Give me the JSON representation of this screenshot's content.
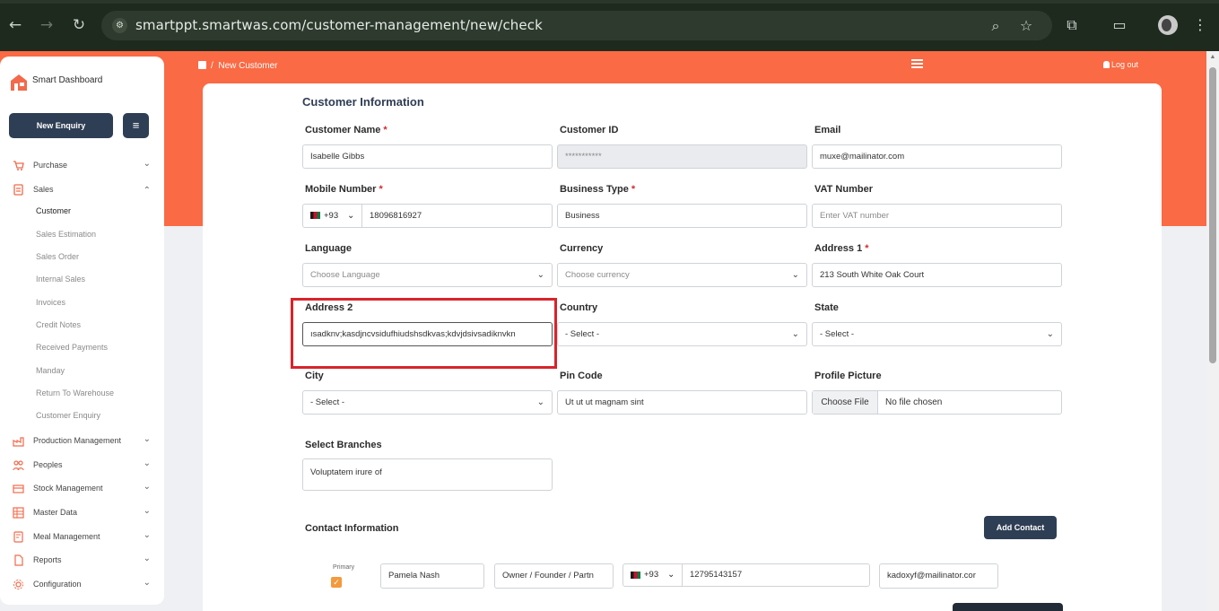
{
  "browser": {
    "url": "smartppt.smartwas.com/customer-management/new/check"
  },
  "sidebar": {
    "brand": "Smart Dashboard",
    "new_enquiry": "New Enquiry",
    "menu_icon": "≡",
    "items": [
      {
        "label": "Purchase",
        "icon": "cart-icon",
        "expanded": false
      },
      {
        "label": "Sales",
        "icon": "sales-icon",
        "expanded": true
      },
      {
        "label": "Production Management",
        "icon": "production-icon",
        "expanded": false
      },
      {
        "label": "Peoples",
        "icon": "people-icon",
        "expanded": false
      },
      {
        "label": "Stock Management",
        "icon": "stock-icon",
        "expanded": false
      },
      {
        "label": "Master Data",
        "icon": "database-icon",
        "expanded": false
      },
      {
        "label": "Meal Management",
        "icon": "meal-icon",
        "expanded": false
      },
      {
        "label": "Reports",
        "icon": "reports-icon",
        "expanded": false
      },
      {
        "label": "Configuration",
        "icon": "config-icon",
        "expanded": false
      }
    ],
    "sales_sub": [
      "Customer",
      "Sales Estimation",
      "Sales Order",
      "Internal Sales",
      "Invoices",
      "Credit Notes",
      "Received Payments",
      "Manday",
      "Return To Warehouse",
      "Customer Enquiry"
    ]
  },
  "header": {
    "breadcrumb_sep": "/",
    "breadcrumb": "New Customer",
    "logout": "Log out"
  },
  "form": {
    "title": "Customer Information",
    "customer_name": {
      "label": "Customer Name",
      "value": "Isabelle Gibbs"
    },
    "customer_id": {
      "label": "Customer ID",
      "value": "***********"
    },
    "email": {
      "label": "Email",
      "value": "muxe@mailinator.com"
    },
    "mobile": {
      "label": "Mobile Number",
      "cc": "+93",
      "value": "18096816927"
    },
    "business_type": {
      "label": "Business Type",
      "value": "Business"
    },
    "vat": {
      "label": "VAT Number",
      "placeholder": "Enter VAT number"
    },
    "language": {
      "label": "Language",
      "value": "Choose Language"
    },
    "currency": {
      "label": "Currency",
      "value": "Choose currency"
    },
    "address1": {
      "label": "Address 1",
      "value": "213 South White Oak Court"
    },
    "address2": {
      "label": "Address 2",
      "value": "ısadknv;kasdjncvsidufhiudshsdkvas;kdvjdsivsadiknvkn"
    },
    "country": {
      "label": "Country",
      "value": "- Select -"
    },
    "state": {
      "label": "State",
      "value": "- Select -"
    },
    "city": {
      "label": "City",
      "value": "- Select -"
    },
    "pin": {
      "label": "Pin Code",
      "value": "Ut ut ut magnam sint"
    },
    "profile": {
      "label": "Profile Picture",
      "button": "Choose File",
      "status": "No file chosen"
    },
    "branches": {
      "label": "Select Branches",
      "value": "Voluptatem irure of"
    }
  },
  "contact": {
    "title": "Contact Information",
    "add_button": "Add Contact",
    "primary_label": "Primary",
    "name": "Pamela Nash",
    "role": "Owner / Founder / Partn",
    "cc": "+93",
    "phone": "12795143157",
    "email": "kadoxyf@mailinator.cor"
  },
  "colors": {
    "accent": "#fa6a44",
    "navy": "#2e3e54",
    "highlight": "#d8242b"
  }
}
